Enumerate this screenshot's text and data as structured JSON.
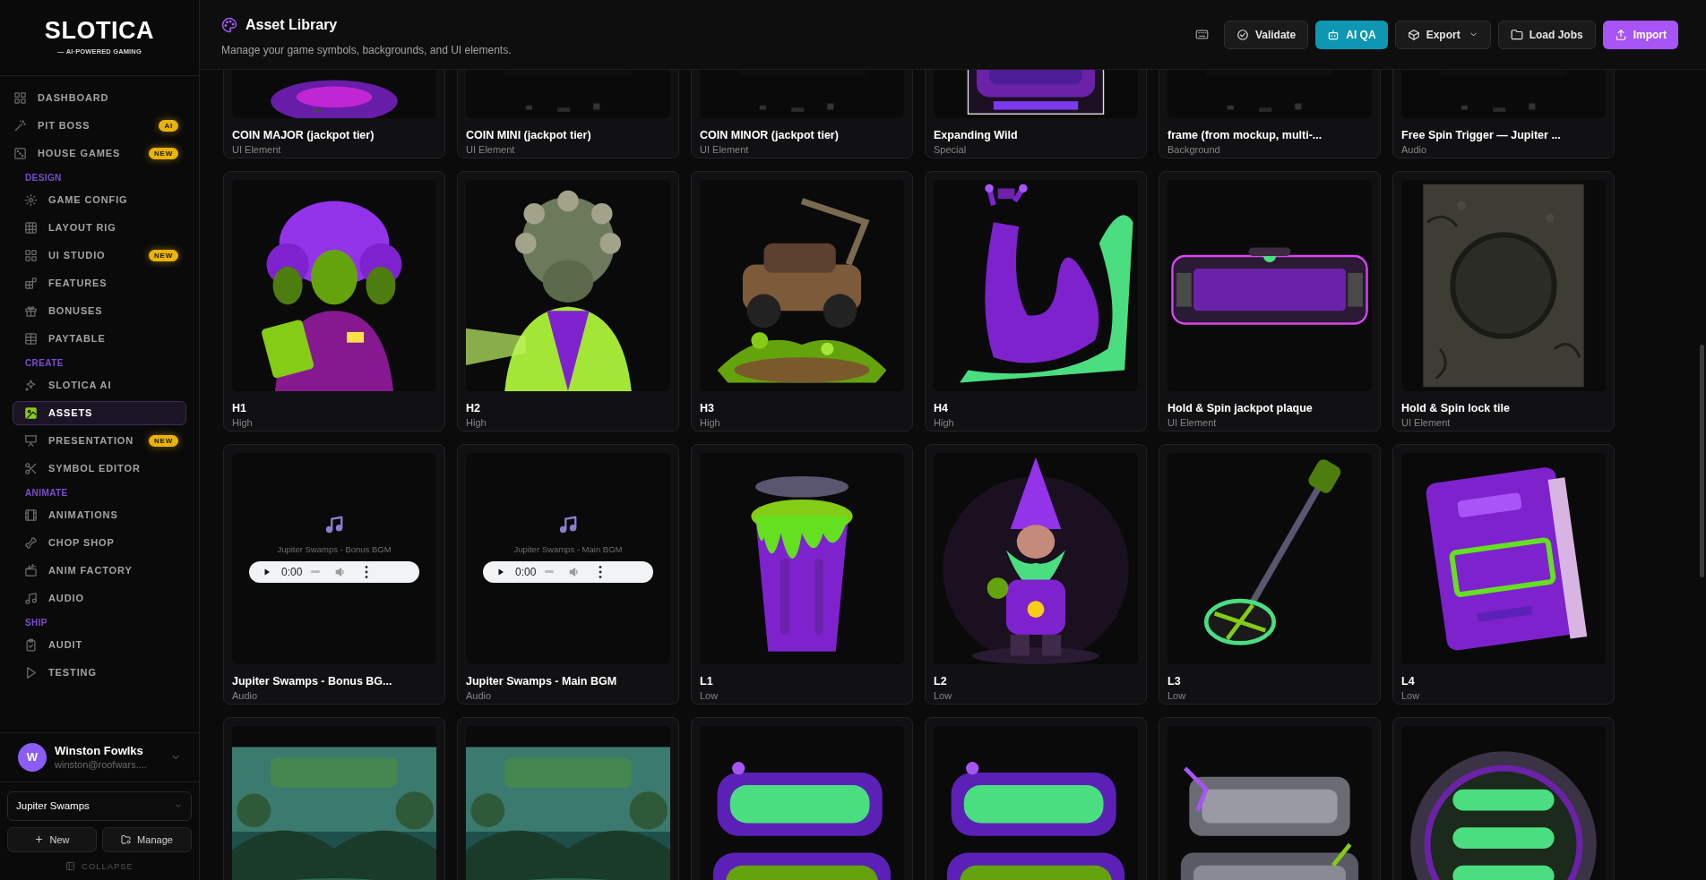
{
  "sidebar": {
    "logo": {
      "name": "SLOTICA",
      "tagline": "— AI·POWERED GAMING"
    },
    "top_items": [
      {
        "label": "DASHBOARD",
        "selected": false
      },
      {
        "label": "PIT BOSS",
        "badge": "AI",
        "selected": false
      },
      {
        "label": "HOUSE GAMES",
        "badge": "NEW",
        "selected": false
      }
    ],
    "sections": [
      {
        "title": "DESIGN",
        "items": [
          {
            "label": "GAME CONFIG",
            "selected": false
          },
          {
            "label": "LAYOUT RIG",
            "selected": false
          },
          {
            "label": "UI STUDIO",
            "badge": "NEW",
            "selected": false
          },
          {
            "label": "FEATURES",
            "selected": false
          },
          {
            "label": "BONUSES",
            "selected": false
          },
          {
            "label": "PAYTABLE",
            "selected": false
          }
        ]
      },
      {
        "title": "CREATE",
        "items": [
          {
            "label": "SLOTICA AI",
            "selected": false
          },
          {
            "label": "ASSETS",
            "selected": true
          },
          {
            "label": "PRESENTATION",
            "badge": "NEW",
            "selected": false
          },
          {
            "label": "SYMBOL EDITOR",
            "selected": false
          }
        ]
      },
      {
        "title": "ANIMATE",
        "items": [
          {
            "label": "ANIMATIONS",
            "selected": false
          },
          {
            "label": "CHOP SHOP",
            "selected": false
          },
          {
            "label": "ANIM FACTORY",
            "selected": false
          },
          {
            "label": "AUDIO",
            "selected": false
          }
        ]
      },
      {
        "title": "SHIP",
        "items": [
          {
            "label": "AUDIT",
            "selected": false
          },
          {
            "label": "TESTING",
            "selected": false
          }
        ]
      }
    ],
    "user": {
      "initial": "W",
      "name": "Winston Fowlks",
      "email": "winston@roofwars...."
    },
    "project": {
      "value": "Jupiter Swamps"
    },
    "buttons": [
      {
        "label": "New"
      },
      {
        "label": "Manage"
      }
    ],
    "collapse": "COLLAPSE"
  },
  "header": {
    "title": "Asset Library",
    "subtitle": "Manage your game symbols, backgrounds, and UI elements.",
    "buttons": [
      {
        "kind": "icon"
      },
      {
        "kind": "button",
        "label": "Validate"
      },
      {
        "kind": "button",
        "label": "AI QA"
      },
      {
        "kind": "menu",
        "label": "Export"
      },
      {
        "kind": "button",
        "label": "Load Jobs"
      },
      {
        "kind": "button",
        "label": "Import"
      }
    ]
  },
  "cards": [
    {
      "kind": "picture",
      "title": "COIN MAJOR (jackpot tier)",
      "category": "UI Element"
    },
    {
      "kind": "picture",
      "title": "COIN MINI (jackpot tier)",
      "category": "UI Element"
    },
    {
      "kind": "picture",
      "title": "COIN MINOR (jackpot tier)",
      "category": "UI Element"
    },
    {
      "kind": "picture",
      "title": "Expanding Wild",
      "category": "Special"
    },
    {
      "kind": "picture",
      "title": "frame (from mockup, multi-...",
      "category": "Background"
    },
    {
      "kind": "picture",
      "title": "Free Spin Trigger — Jupiter ...",
      "category": "Audio"
    },
    {
      "kind": "picture",
      "title": "H1",
      "category": "High"
    },
    {
      "kind": "picture",
      "title": "H2",
      "category": "High"
    },
    {
      "kind": "picture",
      "title": "H3",
      "category": "High"
    },
    {
      "kind": "picture",
      "title": "H4",
      "category": "High"
    },
    {
      "kind": "picture",
      "title": "Hold & Spin jackpot plaque",
      "category": "UI Element"
    },
    {
      "kind": "picture",
      "title": "Hold & Spin lock tile",
      "category": "UI Element"
    },
    {
      "kind": "audio",
      "caption": "Jupiter Swamps - Bonus BGM",
      "time": "0:00",
      "title": "Jupiter Swamps - Bonus BG...",
      "category": "Audio"
    },
    {
      "kind": "audio",
      "caption": "Jupiter Swamps - Main BGM",
      "time": "0:00",
      "title": "Jupiter Swamps - Main BGM",
      "category": "Audio"
    },
    {
      "kind": "picture",
      "title": "L1",
      "category": "Low"
    },
    {
      "kind": "picture",
      "title": "L2",
      "category": "Low"
    },
    {
      "kind": "picture",
      "title": "L3",
      "category": "Low"
    },
    {
      "kind": "picture",
      "title": "L4",
      "category": "Low"
    },
    {
      "kind": "picture"
    },
    {
      "kind": "picture"
    },
    {
      "kind": "picture"
    },
    {
      "kind": "picture"
    },
    {
      "kind": "picture"
    },
    {
      "kind": "picture"
    }
  ]
}
